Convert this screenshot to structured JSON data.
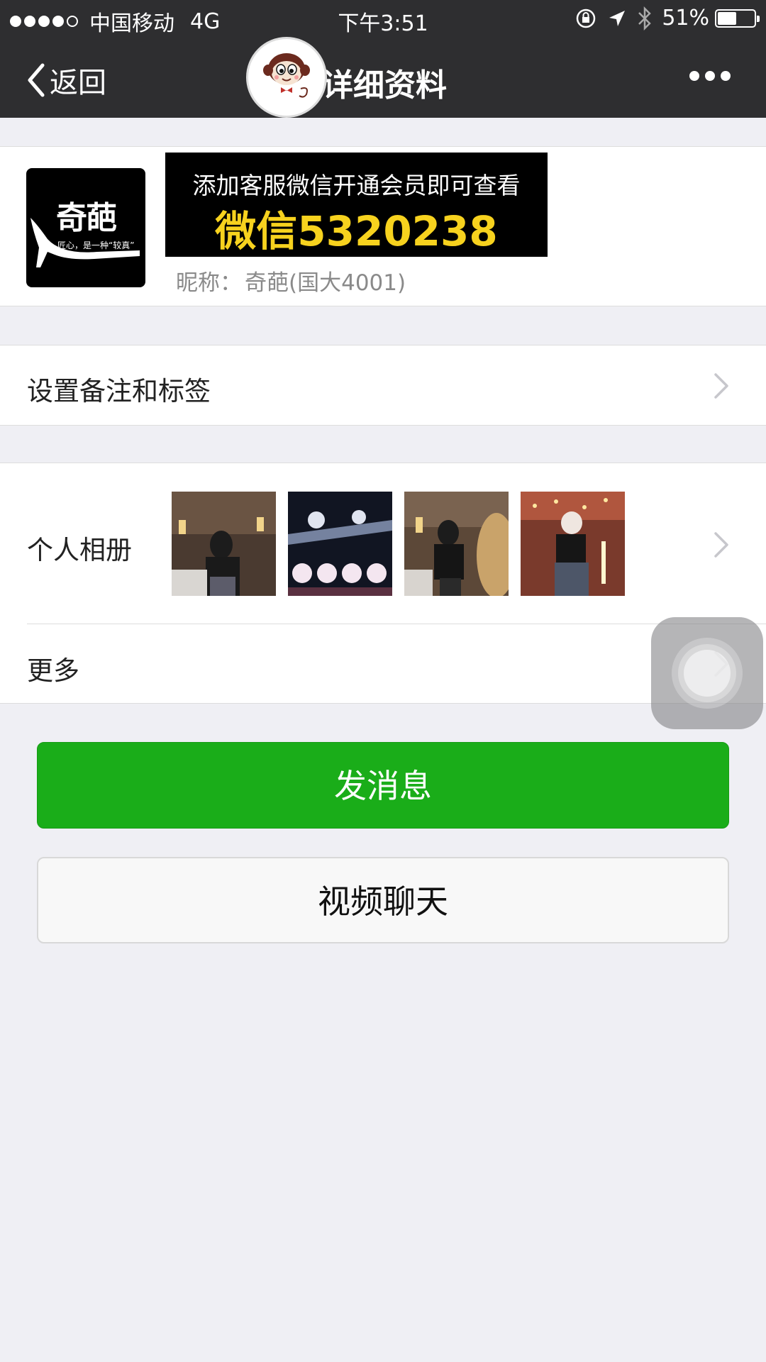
{
  "status_bar": {
    "carrier": "中国移动",
    "network": "4G",
    "time": "下午3:51",
    "battery": "51%",
    "battery_level": 0.51,
    "signal_bars": 4,
    "icons": [
      "rotation-lock-icon",
      "location-arrow-icon",
      "bluetooth-icon",
      "battery-icon"
    ]
  },
  "nav": {
    "back_label": "返回",
    "title": "详细资料",
    "more_icon": "ellipsis-icon"
  },
  "profile": {
    "avatar_text": "奇葩",
    "avatar_subtext": "匠心，是一种“较真”",
    "banner_line1": "添加客服微信开通会员即可查看",
    "banner_line2": "微信5320238",
    "nickname_label": "昵称：",
    "nickname": "奇葩(国大4001)"
  },
  "rows": {
    "remark_label": "设置备注和标签",
    "album_label": "个人相册",
    "more_label": "更多"
  },
  "buttons": {
    "message": "发消息",
    "video_chat": "视频聊天"
  },
  "colors": {
    "nav_bg": "#2e2e30",
    "accent_green": "#1aad19",
    "banner_yellow": "#f7d21e",
    "page_bg": "#efeff4"
  }
}
